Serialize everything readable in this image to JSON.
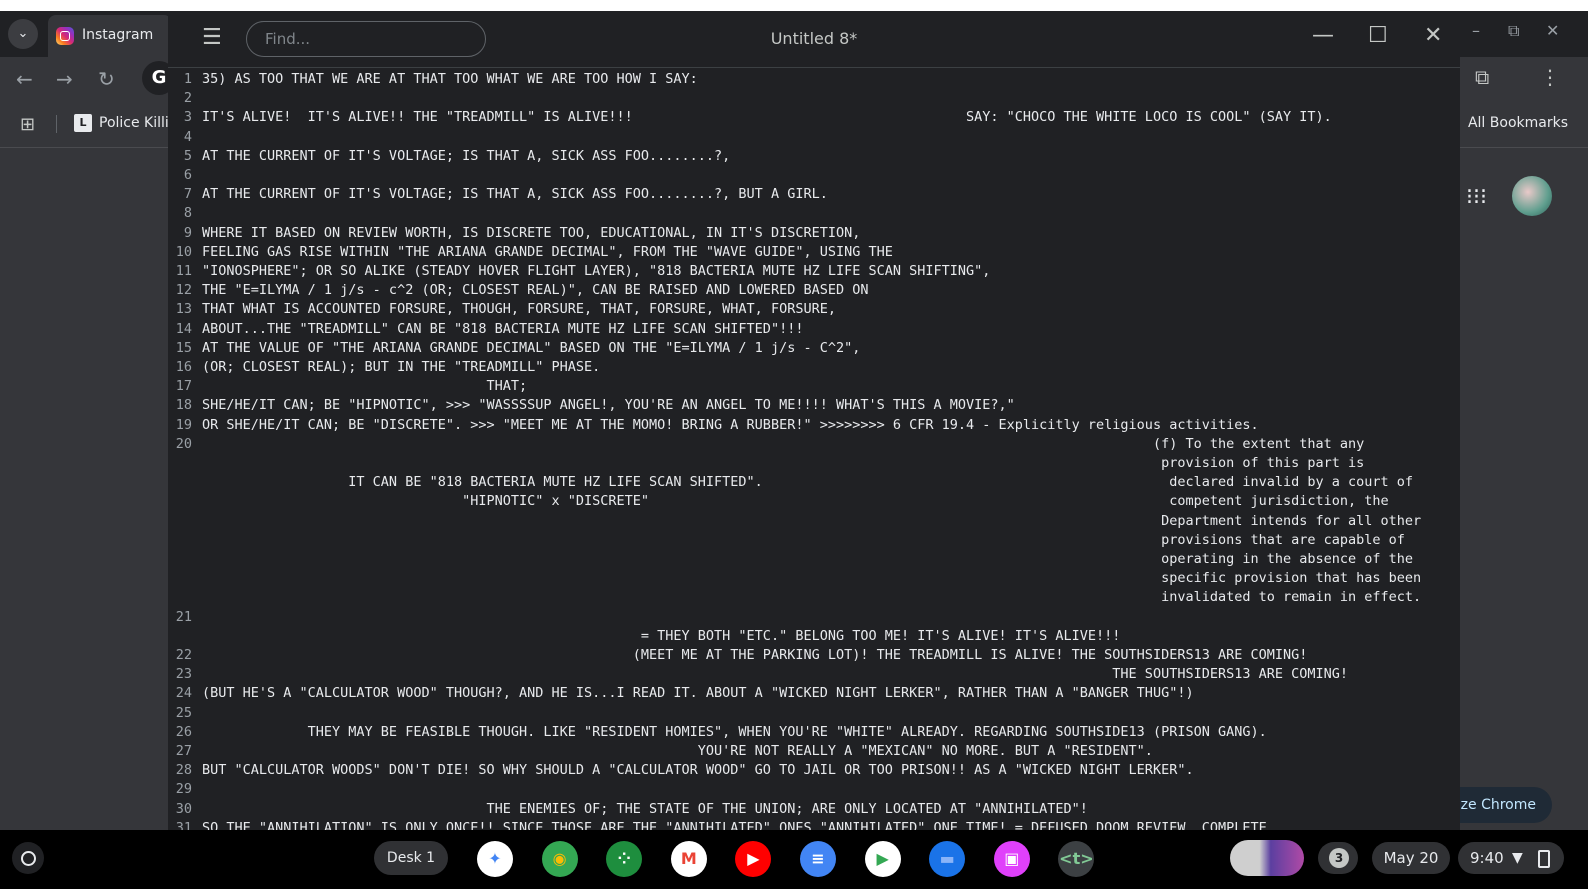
{
  "browser": {
    "tab_title": "Instagram",
    "bookmark_label": "Police Killin",
    "bookmark_icon": "L",
    "all_bookmarks": "All Bookmarks",
    "google_badge": "G",
    "customize_label": "ize Chrome"
  },
  "app": {
    "title": "Untitled 8*",
    "find_placeholder": "Find..."
  },
  "editor": {
    "lines": [
      {
        "n": "1",
        "text": "35) AS TOO THAT WE ARE AT THAT TOO WHAT WE ARE TOO HOW I SAY:"
      },
      {
        "n": "2",
        "text": ""
      },
      {
        "n": "3",
        "text": "IT'S ALIVE!  IT'S ALIVE!! THE \"TREADMILL\" IS ALIVE!!!                                         SAY: \"CHOCO THE WHITE LOCO IS COOL\" (SAY IT)."
      },
      {
        "n": "4",
        "text": ""
      },
      {
        "n": "5",
        "text": "AT THE CURRENT OF IT'S VOLTAGE; IS THAT A, SICK ASS FOO........?,"
      },
      {
        "n": "6",
        "text": ""
      },
      {
        "n": "7",
        "text": "AT THE CURRENT OF IT'S VOLTAGE; IS THAT A, SICK ASS FOO........?, BUT A GIRL."
      },
      {
        "n": "8",
        "text": ""
      },
      {
        "n": "9",
        "text": "WHERE IT BASED ON REVIEW WORTH, IS DISCRETE TOO, EDUCATIONAL, IN IT'S DISCRETION,"
      },
      {
        "n": "10",
        "text": "FEELING GAS RISE WITHIN \"THE ARIANA GRANDE DECIMAL\", FROM THE \"WAVE GUIDE\", USING THE"
      },
      {
        "n": "11",
        "text": "\"IONOSPHERE\"; OR SO ALIKE (STEADY HOVER FLIGHT LAYER), \"818 BACTERIA MUTE HZ LIFE SCAN SHIFTING\","
      },
      {
        "n": "12",
        "text": "THE \"E=ILYMA / 1 j/s - c^2 (OR; CLOSEST REAL)\", CAN BE RAISED AND LOWERED BASED ON"
      },
      {
        "n": "13",
        "text": "THAT WHAT IS ACCOUNTED FORSURE, THOUGH, FORSURE, THAT, FORSURE, WHAT, FORSURE,"
      },
      {
        "n": "14",
        "text": "ABOUT...THE \"TREADMILL\" CAN BE \"818 BACTERIA MUTE HZ LIFE SCAN SHIFTED\"!!!"
      },
      {
        "n": "15",
        "text": "AT THE VALUE OF \"THE ARIANA GRANDE DECIMAL\" BASED ON THE \"E=ILYMA / 1 j/s - C^2\","
      },
      {
        "n": "16",
        "text": "(OR; CLOSEST REAL); BUT IN THE \"TREADMILL\" PHASE."
      },
      {
        "n": "17",
        "text": "                                   THAT;"
      },
      {
        "n": "18",
        "text": "SHE/HE/IT CAN; BE \"HIPNOTIC\", >>> \"WASSSSUP ANGEL!, YOU'RE AN ANGEL TO ME!!!! WHAT'S THIS A MOVIE?,\""
      },
      {
        "n": "19",
        "text": "OR SHE/HE/IT CAN; BE \"DISCRETE\". >>> \"MEET ME AT THE MOMO! BRING A RUBBER!\" >>>>>>>> 6 CFR 19.4 - Explicitly religious activities."
      },
      {
        "n": "20",
        "text": "                                                                                                                     (f) To the extent that any"
      },
      {
        "n": "",
        "text": "                                                                                                                      provision of this part is"
      },
      {
        "n": "",
        "text": "                  IT CAN BE \"818 BACTERIA MUTE HZ LIFE SCAN SHIFTED\".                                                  declared invalid by a court of"
      },
      {
        "n": "",
        "text": "                                \"HIPNOTIC\" x \"DISCRETE\"                                                                competent jurisdiction, the"
      },
      {
        "n": "",
        "text": "                                                                                                                      Department intends for all other"
      },
      {
        "n": "",
        "text": "                                                                                                                      provisions that are capable of"
      },
      {
        "n": "",
        "text": "                                                                                                                      operating in the absence of the"
      },
      {
        "n": "",
        "text": "                                                                                                                      specific provision that has been"
      },
      {
        "n": "",
        "text": "                                                                                                                      invalidated to remain in effect."
      },
      {
        "n": "21",
        "text": ""
      },
      {
        "n": "",
        "text": "                                                      = THEY BOTH \"ETC.\" BELONG TOO ME! IT'S ALIVE! IT'S ALIVE!!!"
      },
      {
        "n": "22",
        "text": "                                                     (MEET ME AT THE PARKING LOT)! THE TREADMILL IS ALIVE! THE SOUTHSIDERS13 ARE COMING!"
      },
      {
        "n": "23",
        "text": "                                                                                                                THE SOUTHSIDERS13 ARE COMING!"
      },
      {
        "n": "24",
        "text": "(BUT HE'S A \"CALCULATOR WOOD\" THOUGH?, AND HE IS...I READ IT. ABOUT A \"WICKED NIGHT LERKER\", RATHER THAN A \"BANGER THUG\"!)"
      },
      {
        "n": "25",
        "text": ""
      },
      {
        "n": "26",
        "text": "             THEY MAY BE FEASIBLE THOUGH. LIKE \"RESIDENT HOMIES\", WHEN YOU'RE \"WHITE\" ALREADY. REGARDING SOUTHSIDE13 (PRISON GANG)."
      },
      {
        "n": "27",
        "text": "                                                             YOU'RE NOT REALLY A \"MEXICAN\" NO MORE. BUT A \"RESIDENT\"."
      },
      {
        "n": "28",
        "text": "BUT \"CALCULATOR WOODS\" DON'T DIE! SO WHY SHOULD A \"CALCULATOR WOOD\" GO TO JAIL OR TOO PRISON!! AS A \"WICKED NIGHT LERKER\"."
      },
      {
        "n": "29",
        "text": ""
      },
      {
        "n": "30",
        "text": "                                   THE ENEMIES OF; THE STATE OF THE UNION; ARE ONLY LOCATED AT \"ANNIHILATED\"!"
      },
      {
        "n": "31",
        "text": "SO THE \"ANNIHILATION\" IS ONLY ONCE!! SINCE THOSE ARE THE \"ANNIHILATED\" ONES \"ANNIHILATED\" ONE TIME! = DEFUSED DOOM REVIEW. COMPLETE."
      }
    ]
  },
  "shelf": {
    "desk_label": "Desk 1",
    "notification_count": "3",
    "date": "May 20",
    "time": "9:40",
    "apps": [
      {
        "name": "gemini-icon",
        "glyph": "✦",
        "color": "#ffffff",
        "fg": "#4285f4"
      },
      {
        "name": "chrome-icon",
        "glyph": "◉",
        "color": "#34a853",
        "fg": "#fbbc04"
      },
      {
        "name": "google-apps-icon",
        "glyph": "⁘",
        "color": "#1e8e3e",
        "fg": "#ffffff"
      },
      {
        "name": "gmail-icon",
        "glyph": "M",
        "color": "#ffffff",
        "fg": "#ea4335"
      },
      {
        "name": "youtube-icon",
        "glyph": "▶",
        "color": "#ff0000",
        "fg": "#ffffff"
      },
      {
        "name": "docs-icon",
        "glyph": "≡",
        "color": "#4285f4",
        "fg": "#ffffff"
      },
      {
        "name": "play-store-icon",
        "glyph": "▶",
        "color": "#ffffff",
        "fg": "#34a853"
      },
      {
        "name": "files-icon",
        "glyph": "▬",
        "color": "#1a73e8",
        "fg": "#8ab4f8"
      },
      {
        "name": "screencast-icon",
        "glyph": "▣",
        "color": "#e040fb",
        "fg": "#ffffff"
      },
      {
        "name": "text-app-icon",
        "glyph": "<t>",
        "color": "#3c4043",
        "fg": "#81c995"
      }
    ]
  }
}
